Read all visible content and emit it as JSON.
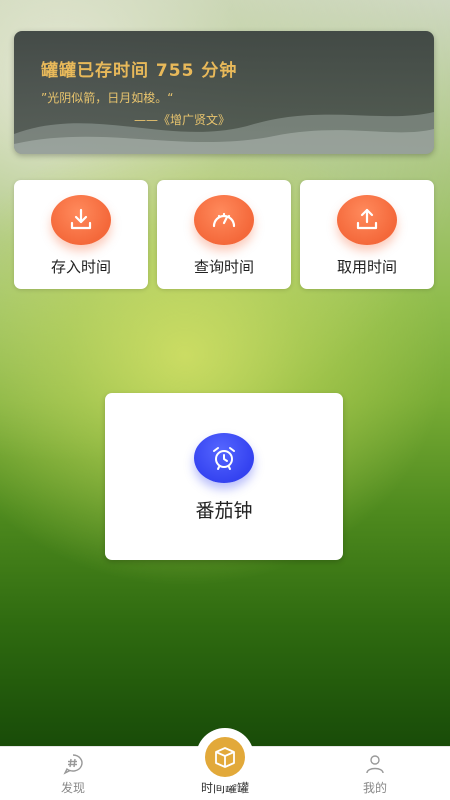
{
  "banner": {
    "title": "罐罐已存时间 755 分钟",
    "quote": "”光阴似箭，日月如梭。“",
    "source": "——《增广贤文》"
  },
  "actions": [
    {
      "label": "存入时间",
      "icon": "download-icon"
    },
    {
      "label": "查询时间",
      "icon": "gauge-icon"
    },
    {
      "label": "取用时间",
      "icon": "upload-icon"
    }
  ],
  "pomodoro": {
    "label": "番茄钟",
    "icon": "alarm-clock-icon"
  },
  "tabs": {
    "discover": "发现",
    "center": "时间罐罐",
    "mine": "我的"
  },
  "colors": {
    "accent_orange": "#f4683a",
    "accent_blue": "#3442f0",
    "banner_text": "#e8b95a",
    "tab_center": "#e2a93a"
  }
}
